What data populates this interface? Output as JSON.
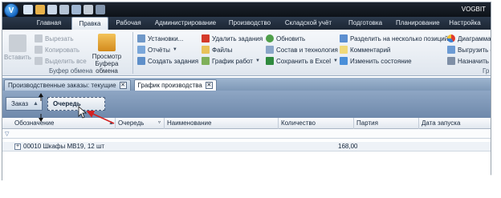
{
  "window": {
    "title": "VOGBIT"
  },
  "ribbon_tabs": [
    {
      "label": "Главная",
      "active": false
    },
    {
      "label": "Правка",
      "active": true
    },
    {
      "label": "Рабочая",
      "active": false
    },
    {
      "label": "Администрирование",
      "active": false
    },
    {
      "label": "Производство",
      "active": false
    },
    {
      "label": "Складской учёт",
      "active": false
    },
    {
      "label": "Подготовка",
      "active": false
    },
    {
      "label": "Планирование",
      "active": false
    },
    {
      "label": "Настройка",
      "active": false
    }
  ],
  "ribbon": {
    "paste": "Вставить",
    "cut": "Вырезать",
    "copy": "Копировать",
    "select_all": "Выделить все",
    "clipboard_view": "Просмотр Буфера обмена",
    "clipboard_group": "Буфер обмена",
    "settings": "Установки...",
    "reports": "Отчёты",
    "create_tasks": "Создать задания",
    "delete_tasks": "Удалить задания",
    "files": "Файлы",
    "work_schedule": "График работ",
    "refresh": "Обновить",
    "composition": "Состав и технология",
    "save_excel": "Сохранить в Excel",
    "split_positions": "Разделить на несколько позиций",
    "comment": "Комментарий",
    "change_state": "Изменить состояние",
    "diagram": "Диаграмма",
    "upload": "Выгрузить фа",
    "assign_exec": "Назначить ис",
    "group_cut_label": "Гр"
  },
  "doc_tabs": [
    {
      "label": "Производственные заказы: текущие",
      "active": false
    },
    {
      "label": "График производства",
      "active": true
    }
  ],
  "group_panel": {
    "chip_order": "Заказ",
    "chip_queue": "Очередь"
  },
  "grid": {
    "columns": [
      "Обозначение",
      "Очередь",
      "Наименование",
      "Количество",
      "Партия",
      "Дата запуска"
    ],
    "group_row": {
      "text": "00010 Шкафы МВ19, 12 шт",
      "quantity": "168,00"
    }
  },
  "colors": {
    "accent_red": "#d42020",
    "titlebar": "#1d2530",
    "group_panel": "#7e98b7"
  }
}
